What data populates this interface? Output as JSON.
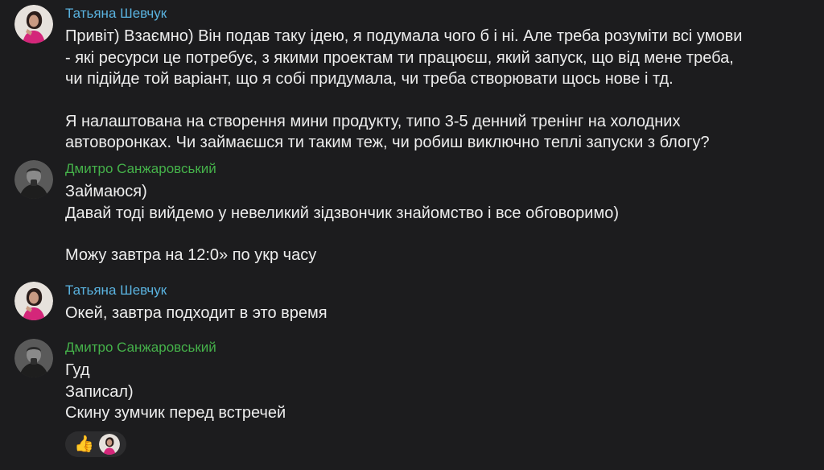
{
  "colors": {
    "background": "#1c1c1e",
    "author_tatyana": "#5ab3e0",
    "author_dmytro": "#45b24a",
    "text": "#ededed"
  },
  "messages": [
    {
      "author": "Татьяна Шевчук",
      "avatar_icon": "tatyana-avatar",
      "paragraphs": [
        [
          "Привіт) Взаємно) Він подав таку ідею, я подумала чого б і ні. Але треба розуміти всі умови",
          "- які ресурси це потребує, з якими проектам ти працюєш, який запуск, що від мене треба,",
          "чи підійде той варіант, що я собі придумала, чи треба створювати щось нове і тд."
        ],
        [
          "Я налаштована на створення мини продукту, типо 3-5 денний тренінг на холодних",
          "автоворонках. Чи займаєшся ти таким теж, чи робиш виключно теплі запуски з блогу?"
        ]
      ]
    },
    {
      "author": "Дмитро Санжаровський",
      "avatar_icon": "dmytro-avatar",
      "paragraphs": [
        [
          "Займаюся)",
          "Давай тоді вийдемо у невеликий зідзвончик знайомство і все обговоримо)"
        ],
        [
          "Можу завтра на 12:0» по укр часу"
        ]
      ]
    },
    {
      "author": "Татьяна Шевчук",
      "avatar_icon": "tatyana-avatar",
      "paragraphs": [
        [
          "Окей, завтра подходит в это время"
        ]
      ]
    },
    {
      "author": "Дмитро Санжаровський",
      "avatar_icon": "dmytro-avatar",
      "paragraphs": [
        [
          "Гуд",
          "Записал)",
          "Скину зумчик перед встречей"
        ]
      ]
    }
  ],
  "reaction": {
    "emoji": "👍",
    "emoji_icon": "thumbs-up-icon",
    "reactor_avatar_icon": "tatyana-avatar"
  }
}
